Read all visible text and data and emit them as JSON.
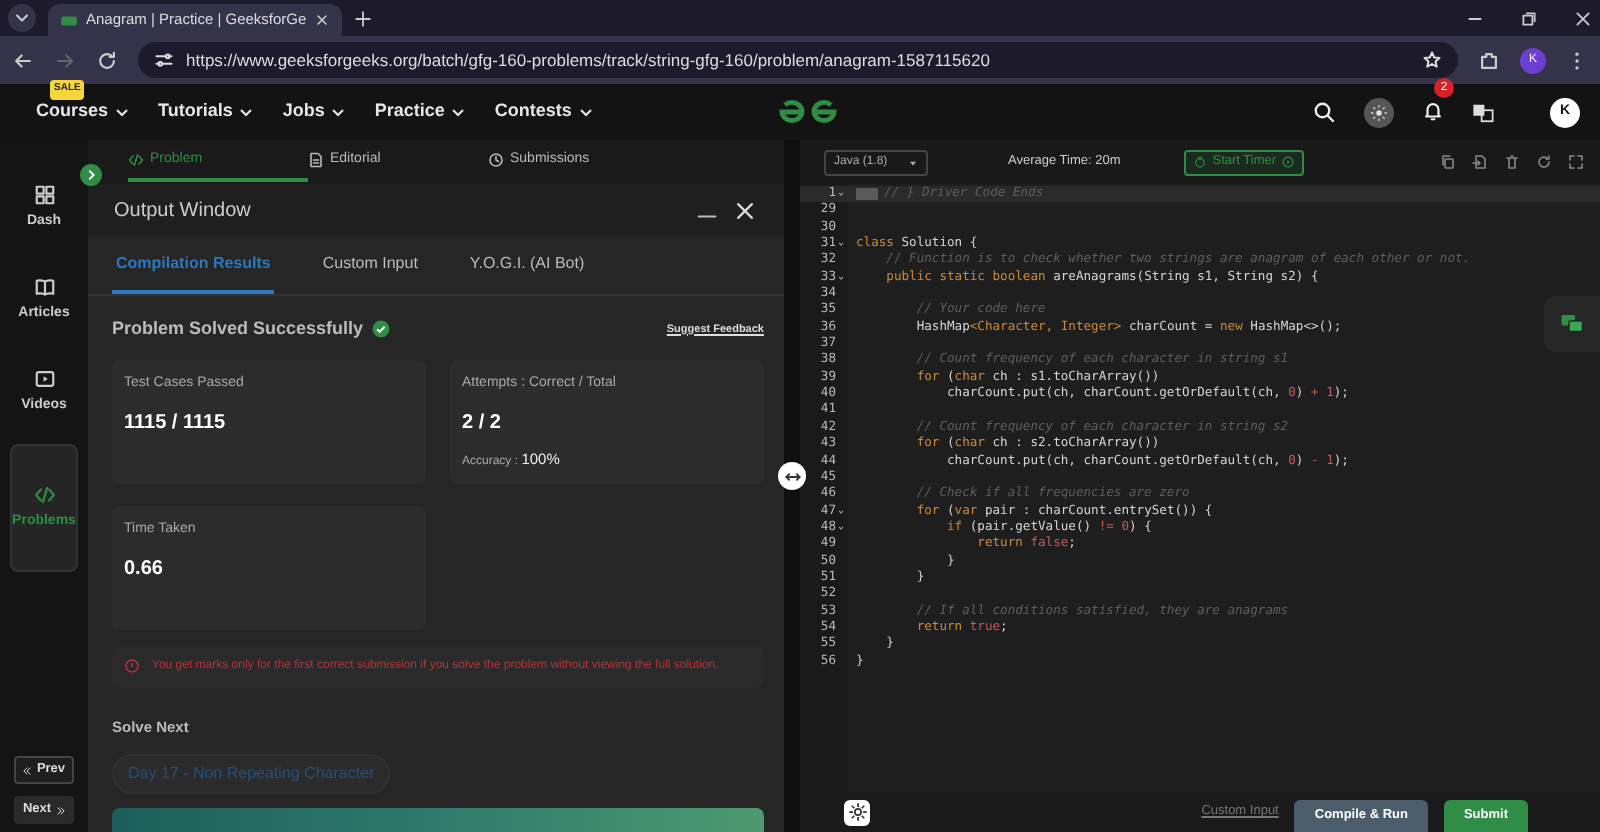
{
  "browser": {
    "tab_title": "Anagram | Practice | GeeksforGe",
    "url": "https://www.geeksforgeeks.org/batch/gfg-160-problems/track/string-gfg-160/problem/anagram-1587115620",
    "profile_initial": "K"
  },
  "site_nav": {
    "items": [
      {
        "label": "Courses",
        "badge": "SALE"
      },
      {
        "label": "Tutorials"
      },
      {
        "label": "Jobs"
      },
      {
        "label": "Practice"
      },
      {
        "label": "Contests"
      }
    ],
    "notification_count": "2",
    "avatar_initial": "K"
  },
  "problem_tabs": [
    {
      "label": "Problem",
      "selected": true
    },
    {
      "label": "Editorial",
      "selected": false
    },
    {
      "label": "Submissions",
      "selected": false
    }
  ],
  "sidebar": {
    "items": [
      {
        "label": "Dash",
        "selected": false
      },
      {
        "label": "Articles",
        "selected": false
      },
      {
        "label": "Videos",
        "selected": false
      },
      {
        "label": "Problems",
        "selected": true
      }
    ],
    "prev": "Prev",
    "next": "Next"
  },
  "output_window": {
    "title": "Output Window",
    "tabs": [
      {
        "label": "Compilation Results",
        "selected": true
      },
      {
        "label": "Custom Input",
        "selected": false
      },
      {
        "label": "Y.O.G.I. (AI Bot)",
        "selected": false
      }
    ],
    "status": "Problem Solved Successfully",
    "feedback_link": "Suggest Feedback",
    "stats": [
      {
        "label": "Test Cases Passed",
        "value": "1115 / 1115"
      },
      {
        "label": "Attempts : Correct / Total",
        "value": "2 / 2",
        "extra_label": "Accuracy :",
        "extra_value": "100%"
      },
      {
        "label": "Time Taken",
        "value": "0.66"
      }
    ],
    "warning": "You get marks only for the first correct submission if you solve the problem without viewing the full solution.",
    "solve_next_heading": "Solve Next",
    "next_problem": "Day 17 - Non Repeating Character"
  },
  "editor": {
    "language": "Java (1.8)",
    "average_time": "Average Time: 20m",
    "timer_button": "Start Timer",
    "lines": [
      {
        "number": "1",
        "fold": true,
        "highlighted": true,
        "tokens": [
          {
            "text": "// } Driver Code Ends",
            "kind": "comment"
          }
        ]
      },
      {
        "number": "29",
        "fold": false,
        "highlighted": false
      },
      {
        "number": "30",
        "fold": false,
        "highlighted": false
      },
      {
        "number": "31",
        "fold": true,
        "highlighted": false,
        "tokens": [
          {
            "text": "class",
            "kind": "keyword"
          },
          {
            "text": " Solution {",
            "kind": "plain"
          }
        ]
      },
      {
        "number": "32",
        "fold": false,
        "highlighted": false,
        "tokens": [
          {
            "text": "    // Function is to check whether two strings are anagram of each other or not.",
            "kind": "comment"
          }
        ]
      },
      {
        "number": "33",
        "fold": true,
        "highlighted": false,
        "tokens": [
          {
            "text": "    public static boolean",
            "kind": "keyword"
          },
          {
            "text": " areAnagrams(String s1, String s2) {",
            "kind": "plain"
          }
        ]
      },
      {
        "number": "34",
        "fold": false,
        "highlighted": false
      },
      {
        "number": "35",
        "fold": false,
        "highlighted": false,
        "tokens": [
          {
            "text": "        // Your code here",
            "kind": "comment"
          }
        ]
      },
      {
        "number": "36",
        "fold": false,
        "highlighted": false,
        "tokens": [
          {
            "text": "        HashMap",
            "kind": "plain"
          },
          {
            "text": "<Character, Integer>",
            "kind": "keyword"
          },
          {
            "text": " charCount = ",
            "kind": "plain"
          },
          {
            "text": "new",
            "kind": "keyword"
          },
          {
            "text": " HashMap<>();",
            "kind": "plain"
          }
        ]
      },
      {
        "number": "37",
        "fold": false,
        "highlighted": false
      },
      {
        "number": "38",
        "fold": false,
        "highlighted": false,
        "tokens": [
          {
            "text": "        // Count frequency of each character in string s1",
            "kind": "comment"
          }
        ]
      },
      {
        "number": "39",
        "fold": false,
        "highlighted": false,
        "tokens": [
          {
            "text": "        for",
            "kind": "keyword"
          },
          {
            "text": " (",
            "kind": "plain"
          },
          {
            "text": "char",
            "kind": "keyword"
          },
          {
            "text": " ch : s1.toCharArray())",
            "kind": "plain"
          }
        ]
      },
      {
        "number": "40",
        "fold": false,
        "highlighted": false,
        "tokens": [
          {
            "text": "            charCount.put(ch, charCount.getOrDefault(ch, ",
            "kind": "plain"
          },
          {
            "text": "0",
            "kind": "literal"
          },
          {
            "text": ") ",
            "kind": "plain"
          },
          {
            "text": "+ 1",
            "kind": "literal"
          },
          {
            "text": ");",
            "kind": "plain"
          }
        ]
      },
      {
        "number": "41",
        "fold": false,
        "highlighted": false
      },
      {
        "number": "42",
        "fold": false,
        "highlighted": false,
        "tokens": [
          {
            "text": "        // Count frequency of each character in string s2",
            "kind": "comment"
          }
        ]
      },
      {
        "number": "43",
        "fold": false,
        "highlighted": false,
        "tokens": [
          {
            "text": "        for",
            "kind": "keyword"
          },
          {
            "text": " (",
            "kind": "plain"
          },
          {
            "text": "char",
            "kind": "keyword"
          },
          {
            "text": " ch : s2.toCharArray())",
            "kind": "plain"
          }
        ]
      },
      {
        "number": "44",
        "fold": false,
        "highlighted": false,
        "tokens": [
          {
            "text": "            charCount.put(ch, charCount.getOrDefault(ch, ",
            "kind": "plain"
          },
          {
            "text": "0",
            "kind": "literal"
          },
          {
            "text": ") ",
            "kind": "plain"
          },
          {
            "text": "- 1",
            "kind": "literal"
          },
          {
            "text": ");",
            "kind": "plain"
          }
        ]
      },
      {
        "number": "45",
        "fold": false,
        "highlighted": false
      },
      {
        "number": "46",
        "fold": false,
        "highlighted": false,
        "tokens": [
          {
            "text": "        // Check if all frequencies are zero",
            "kind": "comment"
          }
        ]
      },
      {
        "number": "47",
        "fold": true,
        "highlighted": false,
        "tokens": [
          {
            "text": "        for",
            "kind": "keyword"
          },
          {
            "text": " (",
            "kind": "plain"
          },
          {
            "text": "var",
            "kind": "keyword"
          },
          {
            "text": " pair : charCount.entrySet()) {",
            "kind": "plain"
          }
        ]
      },
      {
        "number": "48",
        "fold": true,
        "highlighted": false,
        "tokens": [
          {
            "text": "            if",
            "kind": "keyword"
          },
          {
            "text": " (pair.getValue() ",
            "kind": "plain"
          },
          {
            "text": "!= 0",
            "kind": "literal"
          },
          {
            "text": ") {",
            "kind": "plain"
          }
        ]
      },
      {
        "number": "49",
        "fold": false,
        "highlighted": false,
        "tokens": [
          {
            "text": "                return",
            "kind": "keyword"
          },
          {
            "text": " false",
            "kind": "literal"
          },
          {
            "text": ";",
            "kind": "plain"
          }
        ]
      },
      {
        "number": "50",
        "fold": false,
        "highlighted": false,
        "tokens": [
          {
            "text": "            }",
            "kind": "plain"
          }
        ]
      },
      {
        "number": "51",
        "fold": false,
        "highlighted": false,
        "tokens": [
          {
            "text": "        }",
            "kind": "plain"
          }
        ]
      },
      {
        "number": "52",
        "fold": false,
        "highlighted": false
      },
      {
        "number": "53",
        "fold": false,
        "highlighted": false,
        "tokens": [
          {
            "text": "        // If all conditions satisfied, they are anagrams",
            "kind": "comment"
          }
        ]
      },
      {
        "number": "54",
        "fold": false,
        "highlighted": false,
        "tokens": [
          {
            "text": "        return",
            "kind": "keyword"
          },
          {
            "text": " true",
            "kind": "literal"
          },
          {
            "text": ";",
            "kind": "plain"
          }
        ]
      },
      {
        "number": "55",
        "fold": false,
        "highlighted": false,
        "tokens": [
          {
            "text": "    }",
            "kind": "plain"
          }
        ]
      },
      {
        "number": "56",
        "fold": false,
        "highlighted": false,
        "tokens": [
          {
            "text": "}",
            "kind": "plain"
          }
        ]
      }
    ]
  },
  "footer": {
    "custom_input": "Custom Input",
    "compile_button": "Compile & Run",
    "submit_button": "Submit"
  }
}
